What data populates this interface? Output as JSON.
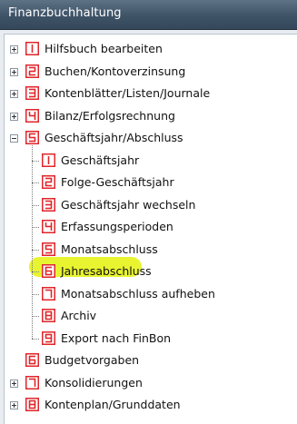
{
  "window": {
    "title": "Finanzbuchhaltung"
  },
  "colors": {
    "icon_red": "#e0262b",
    "highlight": "#e4f20c",
    "titlebar": "#3f5367"
  },
  "tree": {
    "top": [
      {
        "label": "Hilfsbuch bearbeiten",
        "expander": "+",
        "icon": "numeral-1-icon"
      },
      {
        "label": "Buchen/Kontoverzinsung",
        "expander": "+",
        "icon": "numeral-2-icon"
      },
      {
        "label": "Kontenblätter/Listen/Journale",
        "expander": "+",
        "icon": "numeral-3-icon"
      },
      {
        "label": "Bilanz/Erfolgsrechnung",
        "expander": "+",
        "icon": "numeral-4-icon"
      },
      {
        "label": "Geschäftsjahr/Abschluss",
        "expander": "-",
        "icon": "numeral-5-icon"
      }
    ],
    "children": [
      {
        "label": "Geschäftsjahr",
        "icon": "numeral-1-icon"
      },
      {
        "label": "Folge-Geschäftsjahr",
        "icon": "numeral-2-icon"
      },
      {
        "label": "Geschäftsjahr wechseln",
        "icon": "numeral-3-icon"
      },
      {
        "label": "Erfassungsperioden",
        "icon": "numeral-4-icon"
      },
      {
        "label": "Monatsabschluss",
        "icon": "numeral-5-icon"
      },
      {
        "label": "Jahresabschluss",
        "icon": "numeral-6-icon",
        "highlighted": true
      },
      {
        "label": "Monatsabschluss aufheben",
        "icon": "numeral-7-icon"
      },
      {
        "label": "Archiv",
        "icon": "numeral-8-icon"
      },
      {
        "label": "Export nach FinBon",
        "icon": "numeral-9-icon"
      }
    ],
    "bottom": [
      {
        "label": "Budgetvorgaben",
        "expander": "",
        "icon": "numeral-6-icon"
      },
      {
        "label": "Konsolidierungen",
        "expander": "+",
        "icon": "numeral-7-icon"
      },
      {
        "label": "Kontenplan/Grunddaten",
        "expander": "+",
        "icon": "numeral-8-icon"
      }
    ]
  }
}
